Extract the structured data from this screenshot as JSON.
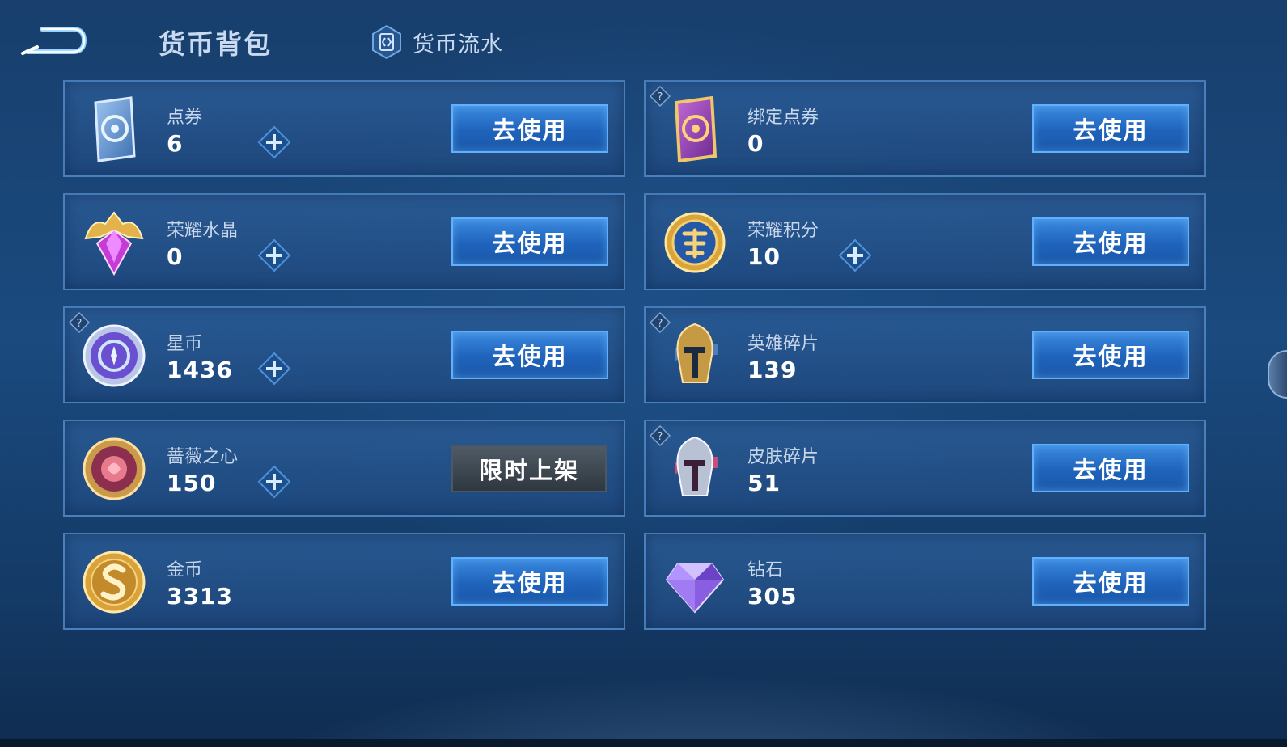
{
  "header": {
    "title": "货币背包",
    "tab_flow_label": "货币流水"
  },
  "cards": [
    {
      "key": "voucher",
      "name": "点券",
      "amount": "6",
      "action": "去使用",
      "icon": "voucher-card-icon",
      "has_plus": true,
      "has_help": false
    },
    {
      "key": "bound-voucher",
      "name": "绑定点券",
      "amount": "0",
      "action": "去使用",
      "icon": "bound-voucher-card-icon",
      "has_plus": false,
      "has_help": true
    },
    {
      "key": "glory-crystal",
      "name": "荣耀水晶",
      "amount": "0",
      "action": "去使用",
      "icon": "glory-crystal-icon",
      "has_plus": true,
      "has_help": false
    },
    {
      "key": "glory-points",
      "name": "荣耀积分",
      "amount": "10",
      "action": "去使用",
      "icon": "glory-points-coin-icon",
      "has_plus": true,
      "has_help": false
    },
    {
      "key": "star-coin",
      "name": "星币",
      "amount": "1436",
      "action": "去使用",
      "icon": "star-coin-icon",
      "has_plus": true,
      "has_help": true
    },
    {
      "key": "hero-shard",
      "name": "英雄碎片",
      "amount": "139",
      "action": "去使用",
      "icon": "hero-helmet-shard-icon",
      "has_plus": false,
      "has_help": true
    },
    {
      "key": "rose-heart",
      "name": "蔷薇之心",
      "amount": "150",
      "action": "限时上架",
      "icon": "rose-heart-coin-icon",
      "has_plus": true,
      "has_help": false,
      "limited": true
    },
    {
      "key": "skin-shard",
      "name": "皮肤碎片",
      "amount": "51",
      "action": "去使用",
      "icon": "skin-helmet-shard-icon",
      "has_plus": false,
      "has_help": true
    },
    {
      "key": "gold-coin",
      "name": "金币",
      "amount": "3313",
      "action": "去使用",
      "icon": "gold-coin-icon",
      "has_plus": false,
      "has_help": false
    },
    {
      "key": "diamond",
      "name": "钻石",
      "amount": "305",
      "action": "去使用",
      "icon": "diamond-icon",
      "has_plus": false,
      "has_help": false
    }
  ],
  "colors": {
    "accent_button": "#1f63bb",
    "limited_button": "#3a434c",
    "card_bg": "#25568f"
  }
}
